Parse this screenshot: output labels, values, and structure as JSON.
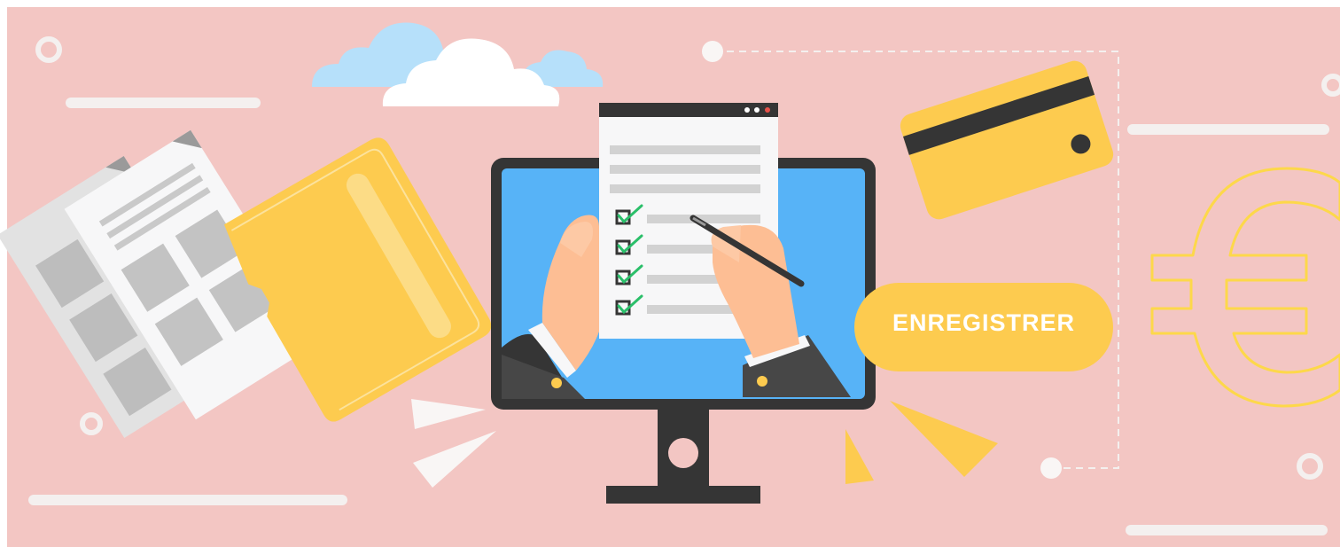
{
  "illustration": {
    "register_button_label": "ENREGISTRER"
  },
  "colors": {
    "background": "#F3C6C3",
    "accent_yellow": "#FDCB4F",
    "screen_blue": "#57B3F7",
    "monitor_dark": "#353535",
    "check_green": "#2BBF6A",
    "paper_white": "#F7F7F8",
    "cloud_blue": "#B6E0FA"
  },
  "icons": [
    "euro-icon",
    "credit-card-icon",
    "folder-icon",
    "cloud-icon",
    "checkbox-icon",
    "pen-icon",
    "monitor-icon"
  ]
}
